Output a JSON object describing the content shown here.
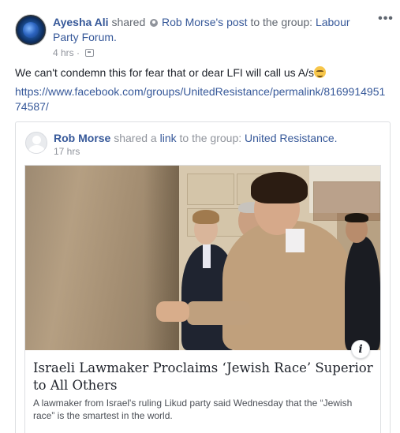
{
  "post": {
    "author": "Ayesha Ali",
    "shared_word": "shared",
    "original_author": "Rob Morse",
    "possessive": "'s",
    "post_word": "post",
    "to_group": "to the group:",
    "group": "Labour Party Forum.",
    "time": "4 hrs",
    "privacy_icon": "group-privacy-icon",
    "more_label": "•••",
    "text": "We can't condemn this for fear that or dear LFI will call us A/s",
    "emoji": "grimacing-face",
    "url": "https://www.facebook.com/groups/UnitedResistance/permalink/816991495174587/"
  },
  "shared": {
    "author": "Rob Morse",
    "shared_a": "shared a",
    "link_word": "link",
    "to_group": "to the group:",
    "group": "United Resistance.",
    "time": "17 hrs",
    "card": {
      "title": "Israeli Lawmaker Proclaims ‘Jewish Race’ Superior to All Others",
      "description": "A lawmaker from Israel's ruling Likud party said Wednesday that the “Jewish race” is the smartest in the world.",
      "info_label": "i"
    }
  },
  "colors": {
    "link_blue": "#365899",
    "meta_gray": "#90949c",
    "text_dark": "#1d2129",
    "border": "#dddfe2"
  }
}
